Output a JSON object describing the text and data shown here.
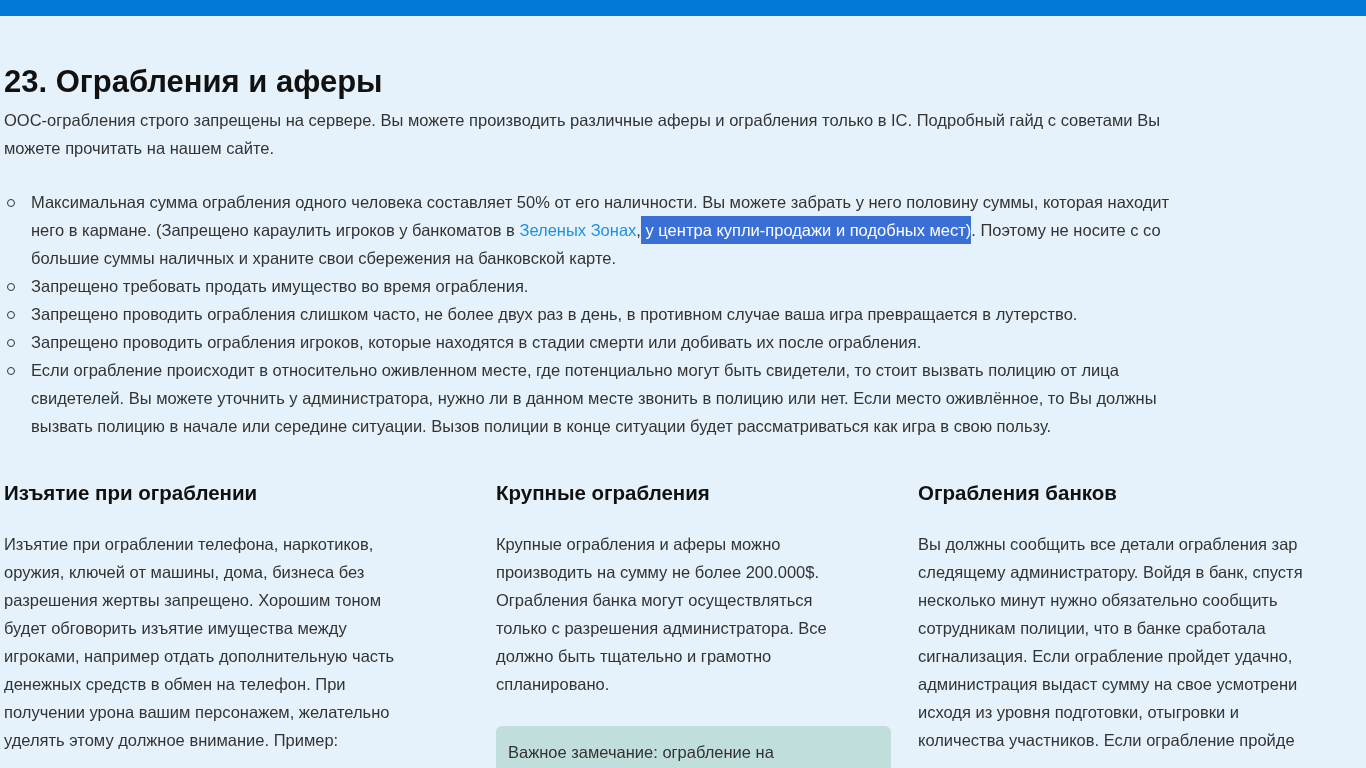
{
  "title": "23. Ограбления и аферы",
  "intro": [
    "ООС-ограбления строго запрещены на сервере. Вы можете производить различные аферы и ограбления только в IC. Подробный гайд с советами Вы",
    "можете прочитать на нашем сайте."
  ],
  "rules": [
    {
      "lines": [
        [
          {
            "kind": "text",
            "text": "Максимальная сумма ограбления одного человека составляет 50% от его наличности. Вы можете забрать у него половину суммы, которая находит"
          }
        ],
        [
          {
            "kind": "text",
            "text": "него в кармане. (Запрещено караулить игроков у банкоматов в "
          },
          {
            "kind": "link",
            "text": "Зеленых Зонах"
          },
          {
            "kind": "text",
            "text": ","
          },
          {
            "kind": "selection",
            "text": " у центра купли-продажи и подобных мест)"
          },
          {
            "kind": "text",
            "text": ". Поэтому не носите с со"
          }
        ],
        [
          {
            "kind": "text",
            "text": "большие суммы наличных и храните свои сбережения на банковской карте."
          }
        ]
      ]
    },
    {
      "lines": [
        [
          {
            "kind": "text",
            "text": "Запрещено требовать продать имущество во время ограбления."
          }
        ]
      ]
    },
    {
      "lines": [
        [
          {
            "kind": "text",
            "text": "Запрещено проводить ограбления слишком часто, не более двух раз в день, в противном случае ваша игра превращается в лутерство."
          }
        ]
      ]
    },
    {
      "lines": [
        [
          {
            "kind": "text",
            "text": "Запрещено проводить ограбления игроков, которые находятся в стадии смерти или добивать их после ограбления."
          }
        ]
      ]
    },
    {
      "lines": [
        [
          {
            "kind": "text",
            "text": "Если ограбление происходит в относительно оживленном месте, где потенциально могут быть свидетели, то стоит вызвать полицию от лица"
          }
        ],
        [
          {
            "kind": "text",
            "text": "свидетелей. Вы можете уточнить у администратора, нужно ли в данном месте звонить в полицию или нет. Если место оживлённое, то Вы должны"
          }
        ],
        [
          {
            "kind": "text",
            "text": "вызвать полицию в начале или середине ситуации. Вызов полиции в конце ситуации будет рассматриваться как игра в свою пользу."
          }
        ]
      ]
    }
  ],
  "sections": [
    {
      "heading": "Изъятие при ограблении",
      "lines": [
        "Изъятие при ограблении телефона, наркотиков,",
        "оружия, ключей от машины, дома, бизнеса без",
        "разрешения жертвы запрещено. Хорошим тоном",
        "будет обговорить изъятие имущества между",
        "игроками, например отдать дополнительную часть",
        "денежных средств в обмен на телефон. При",
        "получении урона вашим персонажем, желательно",
        "уделять этому должное внимание. Пример:"
      ]
    },
    {
      "heading": "Крупные ограбления",
      "lines": [
        "Крупные ограбления и аферы можно",
        "производить на сумму не более 200.000$.",
        "Ограбления банка могут осуществляться",
        "только с разрешения администратора. Все",
        "должно быть тщательно и грамотно",
        "спланировано."
      ],
      "note": "Важное замечание: ограбление на"
    },
    {
      "heading": "Ограбления банков",
      "lines": [
        "Вы должны сообщить все детали ограбления зар",
        "следящему администратору. Войдя в банк, спустя",
        "несколько минут нужно обязательно сообщить",
        "сотрудникам полиции, что в банке сработала",
        "сигнализация. Если ограбление пройдет удачно,",
        "администрация выдаст сумму на свое усмотрени",
        "исходя из уровня подготовки, отыгровки и",
        "количества участников. Если ограбление пройде"
      ]
    }
  ]
}
